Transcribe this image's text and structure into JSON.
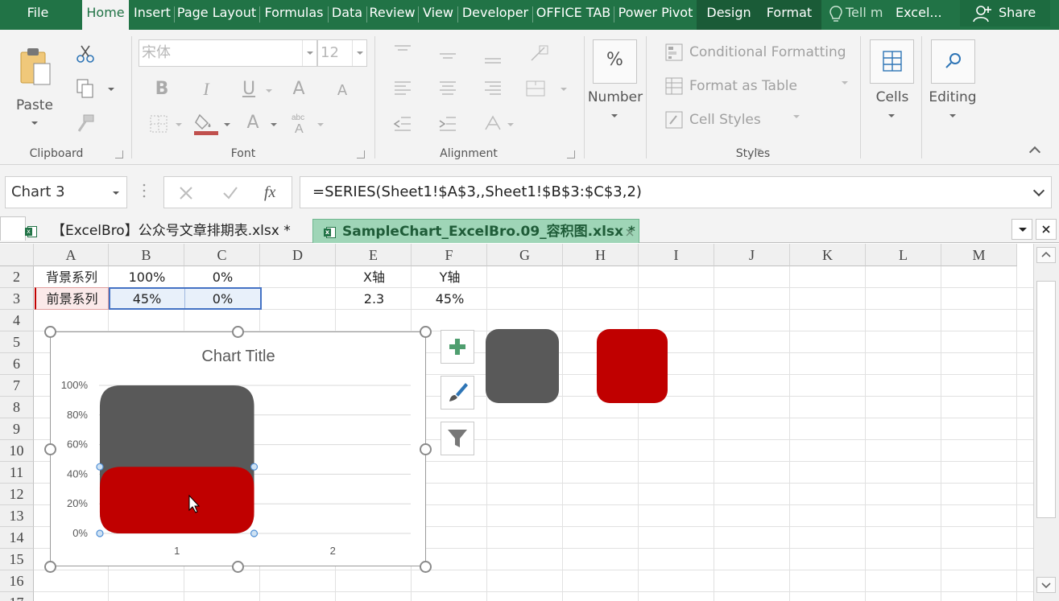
{
  "menu": {
    "tabs": [
      "File",
      "Home",
      "Insert",
      "Page Layout",
      "Formulas",
      "Data",
      "Review",
      "View",
      "Developer",
      "OFFICE TAB",
      "Power Pivot",
      "Design",
      "Format"
    ],
    "tell_me": "Tell m",
    "excel_label": "Excel...",
    "share_label": "Share"
  },
  "ribbon": {
    "clipboard": {
      "paste_label": "Paste",
      "group_label": "Clipboard"
    },
    "font": {
      "font_name": "宋体",
      "font_size": "12",
      "group_label": "Font",
      "b": "B",
      "i": "I",
      "u": "U",
      "grow": "A",
      "shrink": "A",
      "color_a": "A"
    },
    "alignment": {
      "group_label": "Alignment"
    },
    "number": {
      "label": "Number",
      "symbol": "%"
    },
    "styles": {
      "items": [
        "Conditional Formatting",
        "Format as Table",
        "Cell Styles"
      ],
      "group_label": "Styles"
    },
    "cells": {
      "label": "Cells"
    },
    "editing": {
      "label": "Editing"
    }
  },
  "formula_bar": {
    "name_box": "Chart 3",
    "fx": "fx",
    "formula": "=SERIES(Sheet1!$A$3,,Sheet1!$B$3:$C$3,2)"
  },
  "workbooks": {
    "tab1": "【ExcelBro】公众号文章排期表.xlsx *",
    "tab2": "SampleChart_ExcelBro.09_容积图.xlsx *"
  },
  "sheet": {
    "columns": [
      "A",
      "B",
      "C",
      "D",
      "E",
      "F",
      "G",
      "H",
      "I",
      "J",
      "K",
      "L",
      "M"
    ],
    "rows": [
      "2",
      "3",
      "4",
      "5",
      "6",
      "7",
      "8",
      "9",
      "10",
      "11",
      "12",
      "13",
      "14",
      "15",
      "16",
      "17"
    ],
    "row2": {
      "a": "背景系列",
      "b": "100%",
      "c": "0%",
      "e": "X轴",
      "f": "Y轴"
    },
    "row3": {
      "a": "前景系列",
      "b": "45%",
      "c": "0%",
      "e": "2.3",
      "f": "45%"
    }
  },
  "chart_data": {
    "type": "bar",
    "title": "Chart Title",
    "categories": [
      "1",
      "2"
    ],
    "series": [
      {
        "name": "背景系列",
        "values": [
          100,
          0
        ],
        "color": "#595959"
      },
      {
        "name": "前景系列",
        "values": [
          45,
          0
        ],
        "color": "#c00000"
      }
    ],
    "ylim": [
      0,
      100
    ],
    "yticks": [
      "0%",
      "20%",
      "40%",
      "60%",
      "80%",
      "100%"
    ],
    "grid": true
  },
  "colors": {
    "excel_green": "#217346",
    "dark_gray_shape": "#595959",
    "red_shape": "#c00000"
  }
}
